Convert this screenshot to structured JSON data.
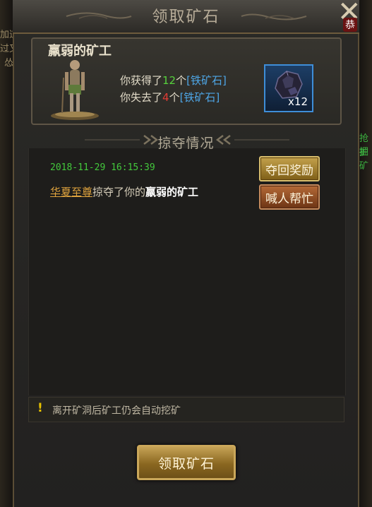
{
  "window": {
    "title": "领取矿石",
    "close_badge": "恭"
  },
  "background_fragments": [
    "加道",
    "过又",
    "怂",
    "抢掘",
    "护矿"
  ],
  "miner": {
    "name": "羸弱的矿工",
    "gain_prefix": "你获得了",
    "gain_count": "12",
    "gain_suffix": "个",
    "lose_prefix": "你失去了",
    "lose_count": "4",
    "lose_suffix": "个",
    "item_name": "[铁矿石]"
  },
  "reward_item": {
    "icon": "ore-icon",
    "count_label": "x12"
  },
  "section_title": "掠夺情况",
  "record": {
    "time": "2018-11-29 16:15:39",
    "player": "华夏至尊",
    "action": "掠夺了你的",
    "target": "羸弱的矿工"
  },
  "buttons": {
    "retake": "夺回奖励",
    "call_help": "喊人帮忙",
    "claim": "领取矿石"
  },
  "tip": {
    "icon": "exclamation-icon",
    "text": "离开矿洞后矿工仍会自动挖矿"
  },
  "colors": {
    "gain": "#56d13c",
    "lose": "#e23c34",
    "item": "#4ea6e6",
    "time": "#43c83c",
    "player": "#e0a43e"
  }
}
